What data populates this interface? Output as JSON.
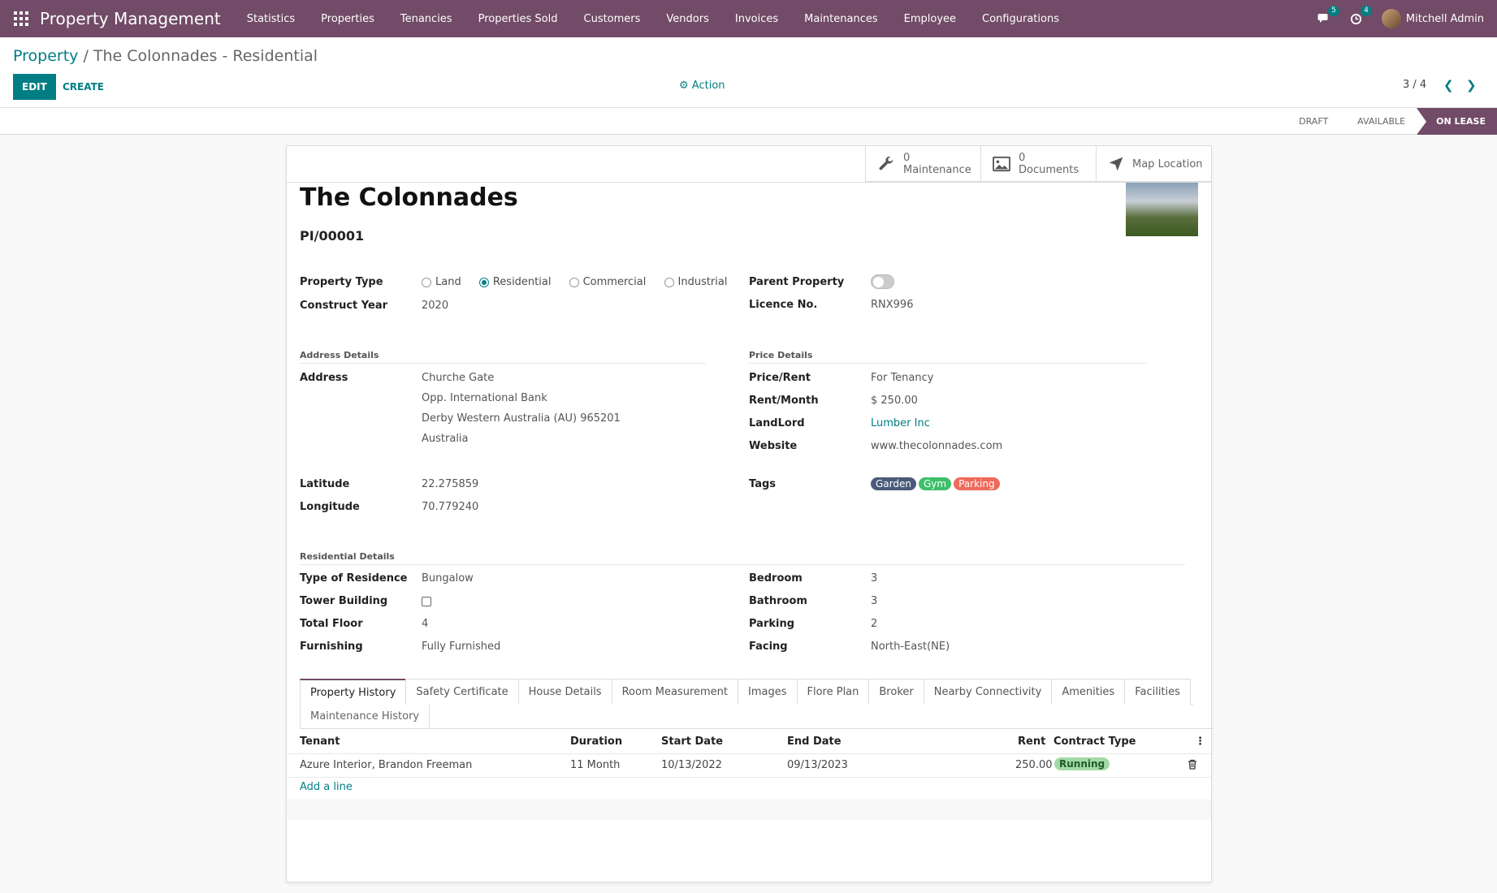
{
  "topbar": {
    "app_title": "Property Management",
    "menu": [
      "Statistics",
      "Properties",
      "Tenancies",
      "Properties Sold",
      "Customers",
      "Vendors",
      "Invoices",
      "Maintenances",
      "Employee",
      "Configurations"
    ],
    "chat_badge": "5",
    "activity_badge": "4",
    "user_name": "Mitchell Admin",
    "accent_color": "#714b67"
  },
  "control_panel": {
    "breadcrumb_root": "Property",
    "breadcrumb_sep": " / ",
    "breadcrumb_current": "The Colonnades - Residential",
    "edit_label": "EDIT",
    "create_label": "CREATE",
    "action_label": "Action",
    "pager": "3 / 4"
  },
  "statusbar": {
    "stages": [
      "DRAFT",
      "AVAILABLE",
      "ON LEASE"
    ],
    "active_stage": "ON LEASE"
  },
  "smart_buttons": {
    "maintenance_count": "0",
    "maintenance_label": "Maintenance",
    "documents_count": "0",
    "documents_label": "Documents",
    "map_label": "Map Location"
  },
  "record": {
    "name": "The Colonnades",
    "code": "PI/00001",
    "property_type": {
      "label": "Property Type",
      "options": [
        "Land",
        "Residential",
        "Commercial",
        "Industrial"
      ],
      "selected": "Residential"
    },
    "construct_year": {
      "label": "Construct Year",
      "value": "2020"
    },
    "parent_property": {
      "label": "Parent Property"
    },
    "licence_no": {
      "label": "Licence No.",
      "value": "RNX996"
    },
    "address_section": "Address Details",
    "address": {
      "label": "Address",
      "lines": [
        "Churche Gate",
        "Opp. International Bank",
        "Derby  Western Australia (AU)  965201",
        "Australia"
      ]
    },
    "latitude": {
      "label": "Latitude",
      "value": "22.275859"
    },
    "longitude": {
      "label": "Longitude",
      "value": "70.779240"
    },
    "price_section": "Price Details",
    "price_rent": {
      "label": "Price/Rent",
      "value": "For Tenancy"
    },
    "rent_month": {
      "label": "Rent/Month",
      "value": "$ 250.00"
    },
    "landlord": {
      "label": "LandLord",
      "value": "Lumber Inc"
    },
    "website": {
      "label": "Website",
      "value": "www.thecolonnades.com"
    },
    "tags": {
      "label": "Tags",
      "items": [
        {
          "name": "Garden",
          "color": "#4a5b7a"
        },
        {
          "name": "Gym",
          "color": "#3dbf6a"
        },
        {
          "name": "Parking",
          "color": "#ee6a5a"
        }
      ]
    },
    "residential_section": "Residential Details",
    "type_of_residence": {
      "label": "Type of Residence",
      "value": "Bungalow"
    },
    "tower_building": {
      "label": "Tower Building"
    },
    "total_floor": {
      "label": "Total Floor",
      "value": "4"
    },
    "furnishing": {
      "label": "Furnishing",
      "value": "Fully Furnished"
    },
    "bedroom": {
      "label": "Bedroom",
      "value": "3"
    },
    "bathroom": {
      "label": "Bathroom",
      "value": "3"
    },
    "parking": {
      "label": "Parking",
      "value": "2"
    },
    "facing": {
      "label": "Facing",
      "value": "North-East(NE)"
    }
  },
  "tabs": {
    "row1": [
      "Property History",
      "Safety Certificate",
      "House Details",
      "Room Measurement",
      "Images",
      "Flore Plan",
      "Broker",
      "Nearby Connectivity",
      "Amenities",
      "Facilities"
    ],
    "row2": [
      "Maintenance History"
    ],
    "active": "Property History"
  },
  "history": {
    "columns": [
      "Tenant",
      "Duration",
      "Start Date",
      "End Date",
      "Rent",
      "Contract Type"
    ],
    "rows": [
      {
        "tenant": "Azure Interior, Brandon Freeman",
        "duration": "11 Month",
        "start": "10/13/2022",
        "end": "09/13/2023",
        "rent": "250.00",
        "contract": "Running"
      }
    ],
    "add_line": "Add a line"
  }
}
